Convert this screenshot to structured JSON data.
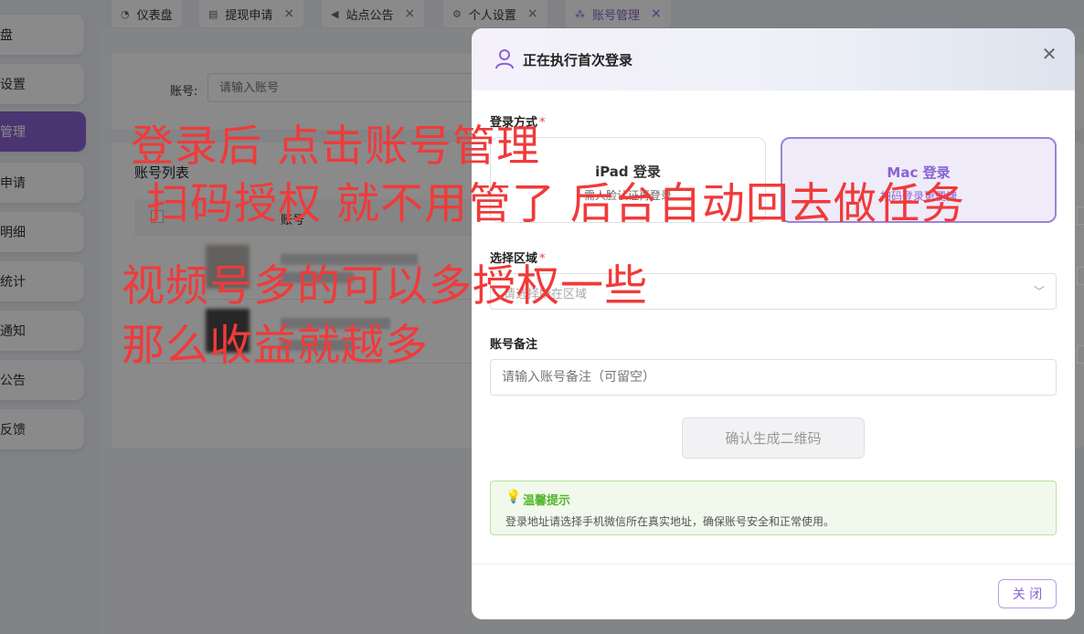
{
  "sidebar": {
    "items": [
      {
        "label": "盘",
        "active": false
      },
      {
        "label": "设置",
        "active": false
      },
      {
        "label": "管理",
        "active": true
      },
      {
        "label": "申请",
        "active": false
      },
      {
        "label": "明细",
        "active": false
      },
      {
        "label": "统计",
        "active": false
      },
      {
        "label": "通知",
        "active": false
      },
      {
        "label": "公告",
        "active": false
      },
      {
        "label": "反馈",
        "active": false
      }
    ]
  },
  "tabs": [
    {
      "label": "仪表盘",
      "icon": "dashboard-icon",
      "closable": false
    },
    {
      "label": "提现申请",
      "icon": "document-icon",
      "closable": true
    },
    {
      "label": "站点公告",
      "icon": "megaphone-icon",
      "closable": true
    },
    {
      "label": "个人设置",
      "icon": "gear-icon",
      "closable": true
    },
    {
      "label": "账号管理",
      "icon": "org-chart-icon",
      "closable": true,
      "active": true
    }
  ],
  "search": {
    "label": "账号:",
    "placeholder": "请输入账号"
  },
  "list": {
    "title": "账号列表",
    "column_account": "账号"
  },
  "dialog": {
    "title": "正在执行首次登录",
    "login_method_label": "登录方式",
    "required_mark": "*",
    "ipad": {
      "title": "iPad 登录",
      "sub": "需人脸认证再登录"
    },
    "mac": {
      "title": "Mac 登录",
      "sub": "扫码登录更便捷"
    },
    "region_label": "选择区域",
    "region_placeholder": "请选择所在区域",
    "remark_label": "账号备注",
    "remark_placeholder": "请输入账号备注（可留空）",
    "generate_button": "确认生成二维码",
    "tip_title": "温馨提示",
    "tip_text": "登录地址请选择手机微信所在真实地址，确保账号安全和正常使用。",
    "close_button": "关 闭"
  },
  "annotations": {
    "line1": "登录后 点击账号管理",
    "line2": "扫码授权 就不用管了 后台自动回去做任务",
    "line3": "视频号多的可以多授权一些",
    "line4": "那么收益就越多"
  },
  "colors": {
    "accent": "#8a63d2",
    "annotation": "#f03a3a",
    "tip_green": "#52b72d",
    "required": "#e04545"
  }
}
